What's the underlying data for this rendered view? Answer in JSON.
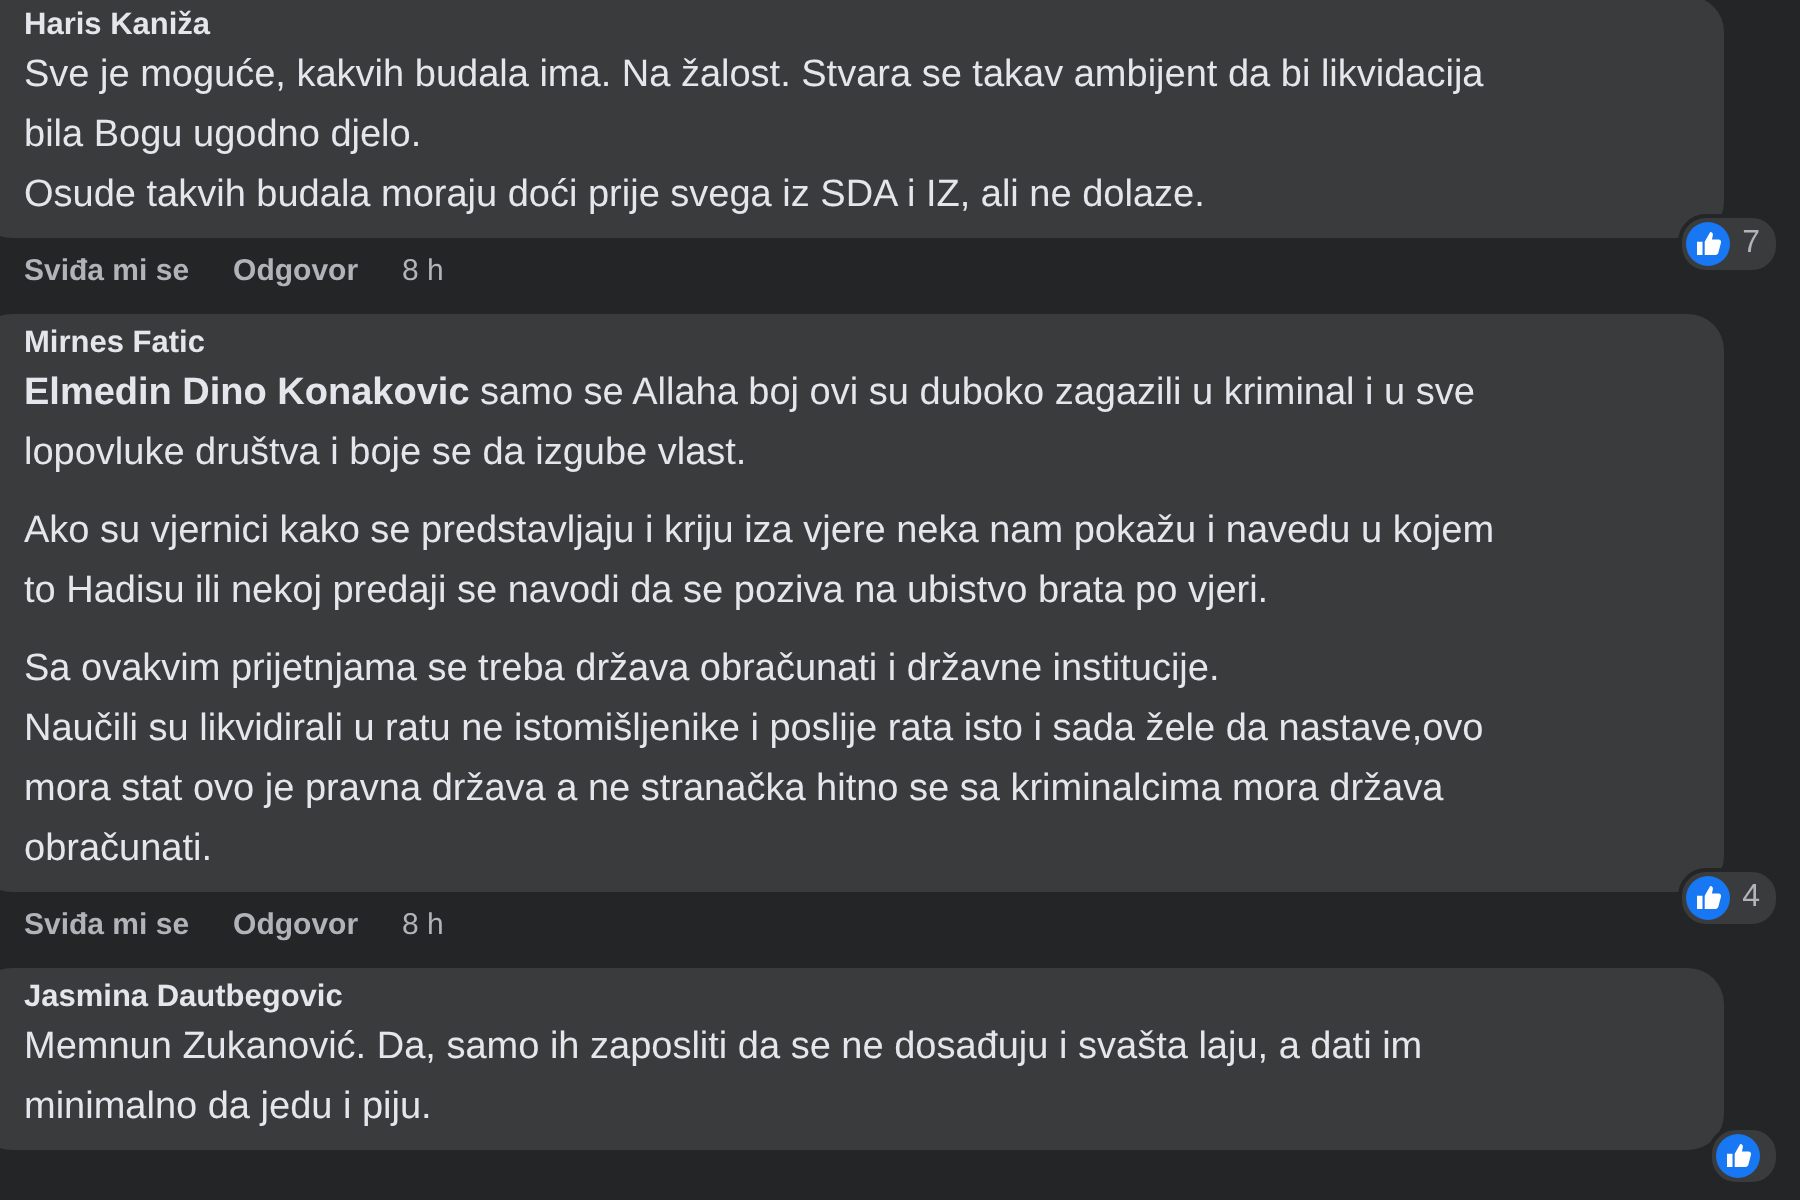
{
  "comments": [
    {
      "author": "Haris Kaniža",
      "paragraphs": [
        "Sve je moguće, kakvih budala ima. Na žalost. Stvara se takav ambijent da bi likvidacija\nbila Bogu ugodno djelo.\nOsude takvih budala moraju doći prije svega iz SDA i IZ, ali ne dolaze."
      ],
      "actions": [
        "Sviđa mi se",
        "Odgovor"
      ],
      "time": "8 h",
      "reaction_count": "7"
    },
    {
      "author": "Mirnes Fatic",
      "paragraphs": [
        "**Elmedin Dino Konakovic** samo se Allaha boj ovi su duboko zagazili u kriminal i u sve\nlopovluke društva i boje se da izgube vlast.",
        "Ako su vjernici kako se predstavljaju i kriju iza vjere neka nam pokažu i navedu u kojem\nto Hadisu ili nekoj predaji se navodi da se poziva na ubistvo brata po vjeri.",
        "Sa ovakvim prijetnjama se treba država obračunati i državne institucije.\nNaučili su likvidirali u ratu ne istomišljenike i poslije rata isto i sada žele da nastave,ovo\nmora stat ovo je pravna država a ne stranačka hitno se sa kriminalcima mora država\nobračunati."
      ],
      "actions": [
        "Sviđa mi se",
        "Odgovor"
      ],
      "time": "8 h",
      "reaction_count": "4"
    },
    {
      "author": "Jasmina Dautbegovic",
      "paragraphs": [
        "Memnun Zukanović. Da, samo ih zaposliti da se ne dosađuju i svašta laju, a dati im\nminimalno da jedu i piju."
      ]
    }
  ]
}
